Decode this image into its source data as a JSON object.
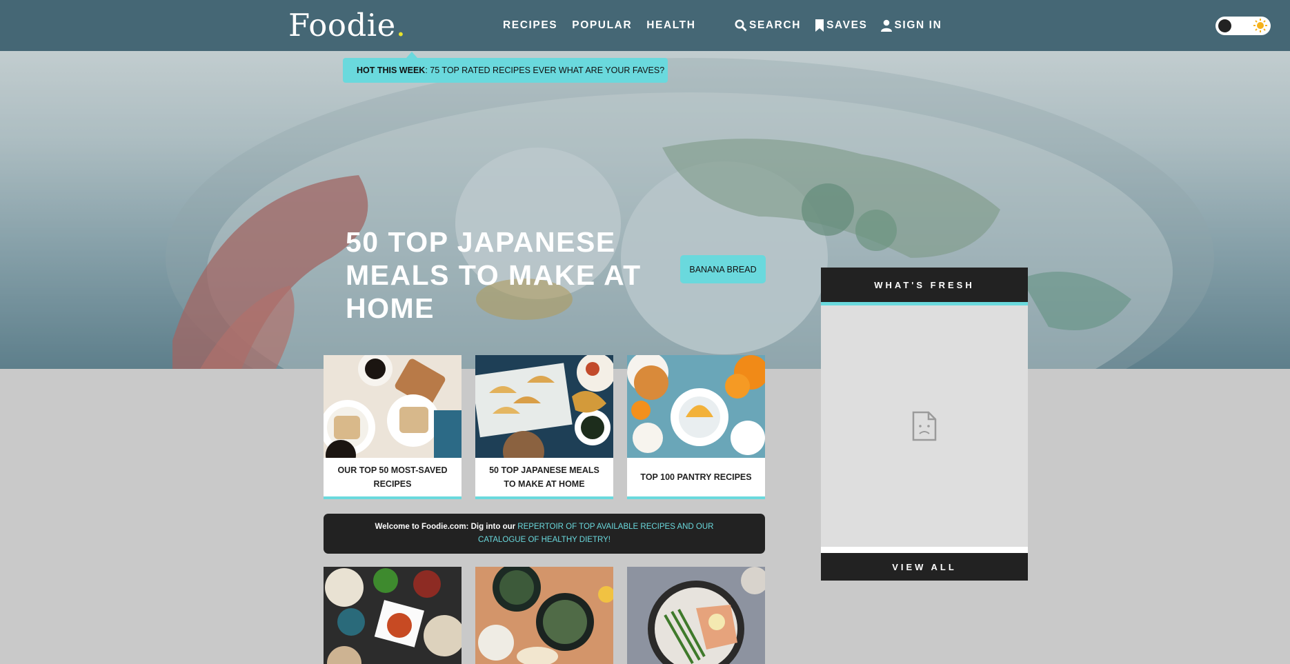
{
  "header": {
    "logo_text": "Foodie",
    "logo_dot": ".",
    "nav": [
      "RECIPES",
      "POPULAR",
      "HEALTH"
    ],
    "search_label": "SEARCH",
    "saves_label": "SAVES",
    "signin_label": "SIGN IN",
    "theme_toggle": {
      "icons": [
        "moon-knob",
        "sun-icon"
      ]
    }
  },
  "hero": {
    "hot_label": "HOT THIS WEEK",
    "hot_text": ": 75 TOP RATED RECIPES EVER WHAT ARE YOUR FAVES?",
    "title": "50 TOP JAPANESE MEALS TO MAKE AT HOME",
    "tag": "BANANA BREAD"
  },
  "fresh": {
    "heading": "WHAT'S FRESH",
    "footer": "VIEW ALL",
    "placeholder_icon": "broken-image-icon"
  },
  "cards": [
    {
      "caption": "OUR TOP 50 MOST-SAVED RECIPES"
    },
    {
      "caption": "50 TOP JAPANESE MEALS TO MAKE AT HOME"
    },
    {
      "caption": "TOP 100 PANTRY RECIPES"
    }
  ],
  "welcome": {
    "text": "Welcome to Foodie.com: Dig into our ",
    "link": "REPERTOIR OF TOP AVAILABLE RECIPES AND OUR CATALOGUE OF HEALTHY DIETRY!"
  },
  "colors": {
    "header": "#456775",
    "accent": "#6ad9dd",
    "dark": "#222222",
    "page": "#c9c9c9"
  }
}
